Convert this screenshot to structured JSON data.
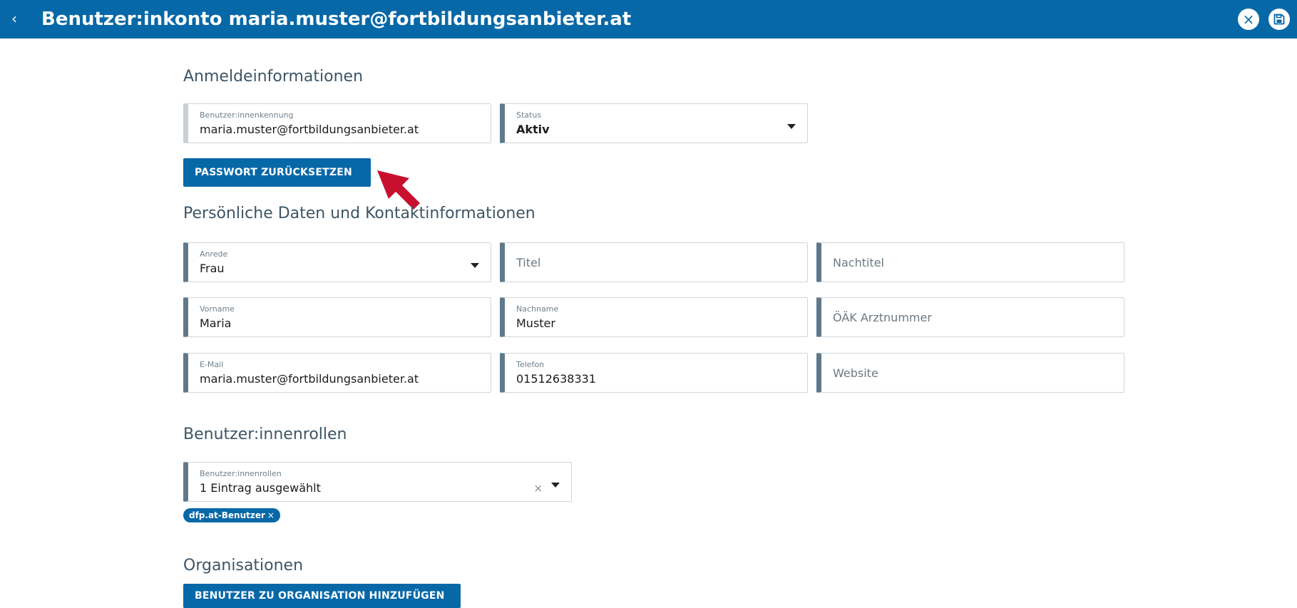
{
  "header": {
    "title": "Benutzer:inkonto maria.muster@fortbildungsanbieter.at",
    "back_icon": "‹",
    "close_icon": "×"
  },
  "sections": {
    "login": "Anmeldeinformationen",
    "personal": "Persönliche Daten und Kontaktinformationen",
    "roles": "Benutzer:innenrollen",
    "orgs": "Organisationen"
  },
  "login": {
    "user_id": {
      "label": "Benutzer:innenkennung",
      "value": "maria.muster@fortbildungsanbieter.at"
    },
    "status": {
      "label": "Status",
      "value": "Aktiv"
    },
    "reset_button": "PASSWORT ZURÜCKSETZEN"
  },
  "personal": {
    "anrede": {
      "label": "Anrede",
      "value": "Frau"
    },
    "titel": {
      "placeholder": "Titel"
    },
    "nachtitel": {
      "placeholder": "Nachtitel"
    },
    "vorname": {
      "label": "Vorname",
      "value": "Maria"
    },
    "nachname": {
      "label": "Nachname",
      "value": "Muster"
    },
    "arztnummer": {
      "placeholder": "ÖÄK Arztnummer"
    },
    "email": {
      "label": "E-Mail",
      "value": "maria.muster@fortbildungsanbieter.at"
    },
    "telefon": {
      "label": "Telefon",
      "value": "01512638331"
    },
    "website": {
      "placeholder": "Website"
    }
  },
  "roles": {
    "field": {
      "label": "Benutzer:innenrollen",
      "value": "1 Eintrag ausgewählt"
    },
    "clear_icon": "×",
    "chips": [
      {
        "label": "dfp.at-Benutzer",
        "remove": "×"
      }
    ]
  },
  "orgs": {
    "add_button": "BENUTZER ZU ORGANISATION HINZUFÜGEN"
  },
  "icons": [
    "chevron-left-icon",
    "close-icon",
    "save-icon",
    "caret-down-icon",
    "pointer-arrow-icon"
  ],
  "colors": {
    "primary": "#0768a8",
    "field_accent": "#60798a",
    "section_title": "#3d5566",
    "annotation_arrow": "#c8102e"
  }
}
